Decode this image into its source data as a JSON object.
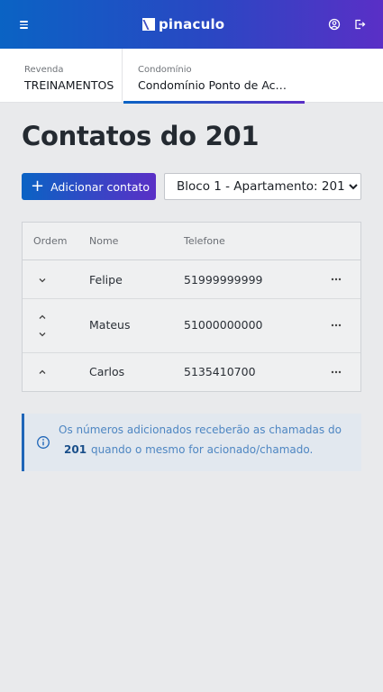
{
  "header": {
    "logo_text": "pinaculo",
    "icons": [
      "menu-icon",
      "user-icon",
      "logout-icon"
    ]
  },
  "context": {
    "revenda_label": "Revenda",
    "revenda_value": "TREINAMENTOS",
    "condominio_label": "Condomínio",
    "condominio_value": "Condomínio Ponto de Acesso"
  },
  "page": {
    "title": "Contatos do 201",
    "add_button_label": "Adicionar contato",
    "unit_selected": "Bloco 1 - Apartamento: 201"
  },
  "table": {
    "columns": [
      "Ordem",
      "Nome",
      "Telefone"
    ],
    "rows": [
      {
        "name": "Felipe",
        "phone": "51999999999",
        "can_move_up": false,
        "can_move_down": true
      },
      {
        "name": "Mateus",
        "phone": "51000000000",
        "can_move_up": true,
        "can_move_down": true
      },
      {
        "name": "Carlos",
        "phone": "5135410700",
        "can_move_up": true,
        "can_move_down": false
      }
    ]
  },
  "info": {
    "line1": "Os números adicionados receberão as chamadas do",
    "apartment": "201",
    "line2": "quando o mesmo for acionado/chamado."
  },
  "colors": {
    "gradient_start": "#0a63c4",
    "gradient_end": "#5a2fc6",
    "info_accent": "#1f66b8"
  }
}
